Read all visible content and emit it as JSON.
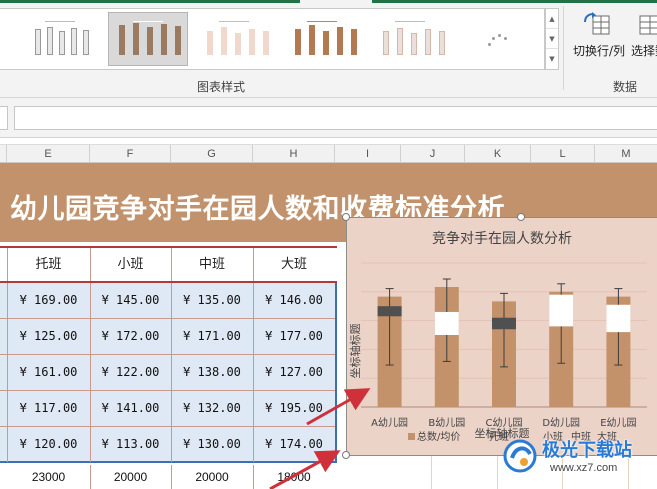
{
  "ribbon": {
    "chart_styles_group": "图表样式",
    "data_group": "数据",
    "switch_row_col": "切换行/列",
    "select_data": "选择数"
  },
  "grid": {
    "columns": [
      "E",
      "F",
      "G",
      "H",
      "I",
      "J",
      "K",
      "L",
      "M"
    ]
  },
  "sheet": {
    "title": "幼儿园竞争对手在园人数和收费标准分析",
    "headers": [
      "托班",
      "小班",
      "中班",
      "大班"
    ],
    "rows": [
      [
        "¥ 169.00",
        "¥ 145.00",
        "¥ 135.00",
        "¥ 146.00"
      ],
      [
        "¥ 125.00",
        "¥ 172.00",
        "¥ 171.00",
        "¥ 177.00"
      ],
      [
        "¥ 161.00",
        "¥ 122.00",
        "¥ 138.00",
        "¥ 127.00"
      ],
      [
        "¥ 117.00",
        "¥ 141.00",
        "¥ 132.00",
        "¥ 195.00"
      ],
      [
        "¥ 120.00",
        "¥ 113.00",
        "¥ 130.00",
        "¥ 174.00"
      ]
    ],
    "totals": [
      "23000",
      "20000",
      "20000",
      "18000"
    ]
  },
  "chart_data": {
    "type": "bar",
    "title": "竞争对手在园人数分析",
    "xlabel": "坐标轴标题",
    "ylabel": "坐标轴标题",
    "categories": [
      "A幼儿园",
      "B幼儿园",
      "C幼儿园",
      "D幼儿园",
      "E幼儿园"
    ],
    "legend": [
      "总数/均价",
      "托班",
      "小班",
      "中班",
      "大班"
    ],
    "series": [
      {
        "name": "总数/均价",
        "values": [
          23000,
          25000,
          22000,
          24000,
          23000
        ]
      }
    ],
    "ylim": [
      0,
      30000
    ],
    "colors": {
      "bar": "#c4926a",
      "background": "#ecd3c8",
      "dark_box": "#505050",
      "light_box": "#ffffff"
    }
  },
  "watermark": {
    "text": "极光下载站",
    "url": "www.xz7.com",
    "color": "#2a7bd6"
  },
  "colors": {
    "banner": "#c1926b",
    "table_body": "#dfe8f5",
    "header_border": "#b33a3a",
    "selection_blue": "#3b6fb6",
    "arrow": "#d0303a",
    "excel_green": "#217346"
  }
}
